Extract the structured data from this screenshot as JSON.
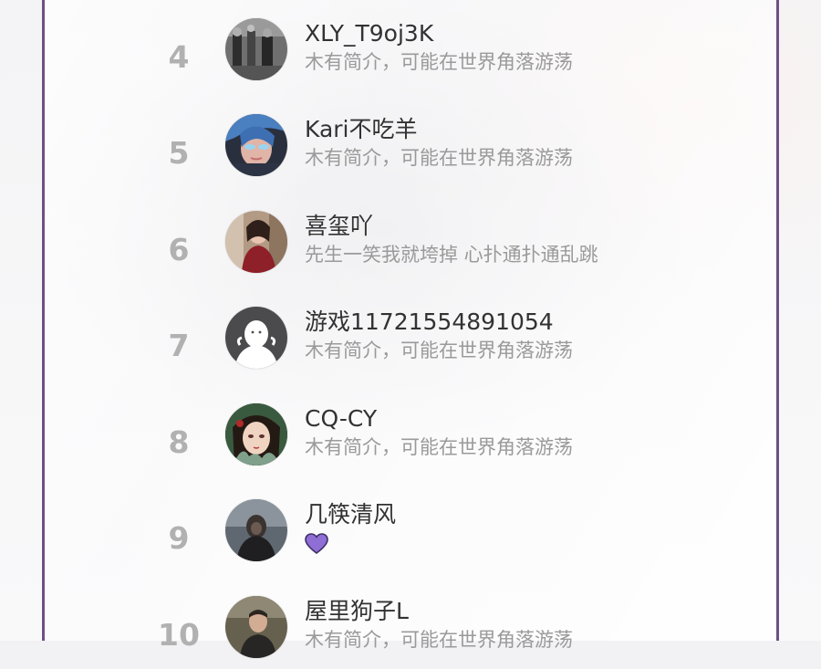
{
  "ranking": [
    {
      "rank": "4",
      "name": "XLY_T9oj3K",
      "bio": "木有简介，可能在世界角落游荡",
      "avatar_icon": "grayscale-photo-avatar"
    },
    {
      "rank": "5",
      "name": "Kari不吃羊",
      "bio": "木有简介，可能在世界角落游荡",
      "avatar_icon": "blue-hair-girl-avatar"
    },
    {
      "rank": "6",
      "name": "喜玺吖",
      "bio": "先生一笑我就垮掉 心扑通扑通乱跳",
      "avatar_icon": "red-dress-girl-avatar"
    },
    {
      "rank": "7",
      "name": "游戏11721554891054",
      "bio": "木有简介，可能在世界角落游荡",
      "avatar_icon": "default-user-avatar"
    },
    {
      "rank": "8",
      "name": "CQ-CY",
      "bio": "木有简介，可能在世界角落游荡",
      "avatar_icon": "anime-girl-avatar"
    },
    {
      "rank": "9",
      "name": "几筷清风",
      "bio_icon": "purple-heart-icon",
      "avatar_icon": "dark-portrait-avatar"
    },
    {
      "rank": "10",
      "name": "屋里狗子L",
      "bio": "木有简介，可能在世界角落游荡",
      "avatar_icon": "man-portrait-avatar"
    }
  ],
  "colors": {
    "frame": "#6e4f86",
    "rank_text": "#b1b1b1",
    "name_text": "#323232",
    "bio_text": "#9a9a9a",
    "heart": "#8f6ed5"
  }
}
